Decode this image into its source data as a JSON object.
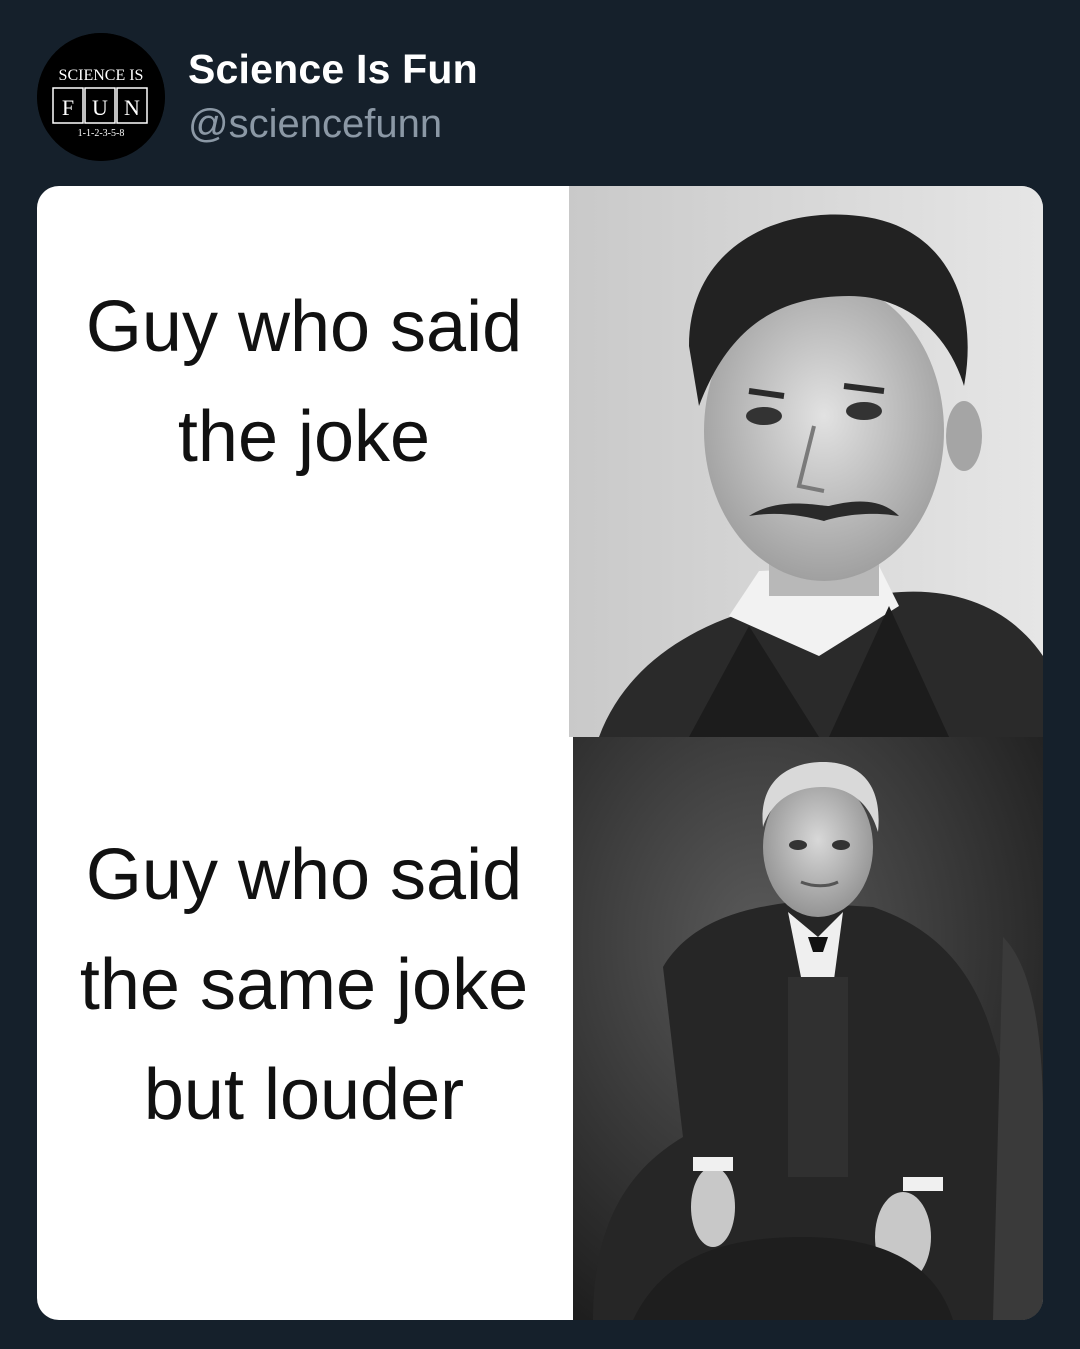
{
  "post": {
    "avatar": {
      "icon": "science-is-fun-logo-icon",
      "top_text": "SCIENCE IS",
      "letters": [
        "F",
        "U",
        "N"
      ],
      "bottom_text": "1-1-2-3-5-8"
    },
    "display_name": "Science Is Fun",
    "handle": "@sciencefunn"
  },
  "meme": {
    "panels": [
      {
        "caption_lines": [
          "Guy who said",
          "the joke"
        ],
        "photo": "portrait-young-man-mustache"
      },
      {
        "caption_lines": [
          "Guy who said",
          "the same joke",
          "but louder"
        ],
        "photo": "portrait-seated-older-man"
      }
    ]
  },
  "colors": {
    "background": "#15202b",
    "display_name": "#ffffff",
    "handle": "#8b98a5",
    "media_background": "#ffffff",
    "caption_text": "#111111"
  }
}
